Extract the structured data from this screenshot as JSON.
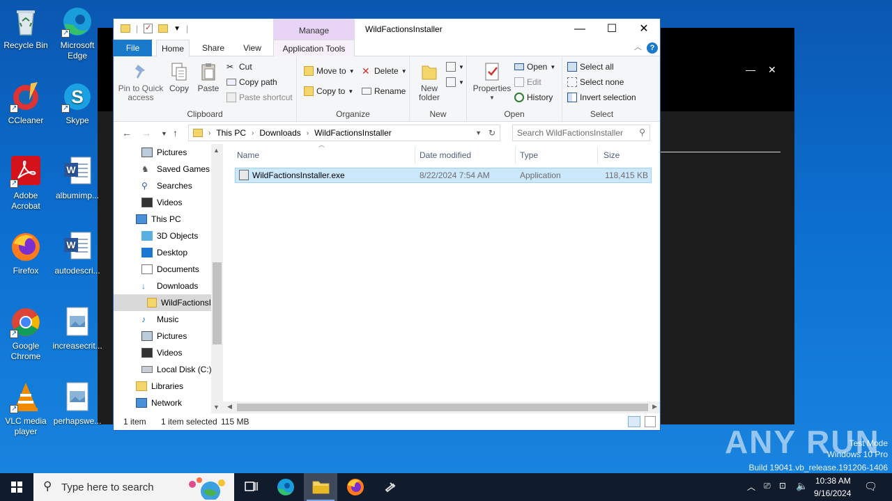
{
  "desktop_icons": [
    {
      "label": "Recycle Bin",
      "icon": "recycle-bin-icon"
    },
    {
      "label": "Microsoft Edge",
      "icon": "edge-icon"
    },
    {
      "label": "CCleaner",
      "icon": "ccleaner-icon"
    },
    {
      "label": "Skype",
      "icon": "skype-icon"
    },
    {
      "label": "Adobe Acrobat",
      "icon": "acrobat-icon"
    },
    {
      "label": "albumimp...",
      "icon": "word-doc-icon"
    },
    {
      "label": "Firefox",
      "icon": "firefox-icon"
    },
    {
      "label": "autodescri...",
      "icon": "word-doc-icon"
    },
    {
      "label": "Google Chrome",
      "icon": "chrome-icon"
    },
    {
      "label": "increasecrit...",
      "icon": "image-file-icon"
    },
    {
      "label": "VLC media player",
      "icon": "vlc-icon"
    },
    {
      "label": "perhapswe...",
      "icon": "image-file-icon"
    }
  ],
  "window": {
    "title": "WildFactionsInstaller",
    "manage_tab": "Manage",
    "tabs": {
      "file": "File",
      "home": "Home",
      "share": "Share",
      "view": "View",
      "app_tools": "Application Tools"
    }
  },
  "ribbon": {
    "clipboard": {
      "label": "Clipboard",
      "pin": "Pin to Quick access",
      "copy": "Copy",
      "paste": "Paste",
      "cut": "Cut",
      "copy_path": "Copy path",
      "paste_shortcut": "Paste shortcut"
    },
    "organize": {
      "label": "Organize",
      "move_to": "Move to",
      "copy_to": "Copy to",
      "delete": "Delete",
      "rename": "Rename"
    },
    "new": {
      "label": "New",
      "new_folder": "New folder"
    },
    "open": {
      "label": "Open",
      "properties": "Properties",
      "open": "Open",
      "edit": "Edit",
      "history": "History"
    },
    "select": {
      "label": "Select",
      "select_all": "Select all",
      "select_none": "Select none",
      "invert": "Invert selection"
    }
  },
  "address": {
    "crumbs": [
      "This PC",
      "Downloads",
      "WildFactionsInstaller"
    ],
    "search_placeholder": "Search WildFactionsInstaller"
  },
  "nav_items": [
    {
      "label": "Pictures",
      "icon": "pictures-folder-icon"
    },
    {
      "label": "Saved Games",
      "icon": "saved-games-icon"
    },
    {
      "label": "Searches",
      "icon": "searches-icon"
    },
    {
      "label": "Videos",
      "icon": "videos-folder-icon"
    },
    {
      "label": "This PC",
      "icon": "this-pc-icon"
    },
    {
      "label": "3D Objects",
      "icon": "3d-objects-icon"
    },
    {
      "label": "Desktop",
      "icon": "desktop-folder-icon"
    },
    {
      "label": "Documents",
      "icon": "documents-folder-icon"
    },
    {
      "label": "Downloads",
      "icon": "downloads-folder-icon"
    },
    {
      "label": "WildFactionsI",
      "icon": "folder-icon"
    },
    {
      "label": "Music",
      "icon": "music-folder-icon"
    },
    {
      "label": "Pictures",
      "icon": "pictures-folder-icon"
    },
    {
      "label": "Videos",
      "icon": "videos-folder-icon"
    },
    {
      "label": "Local Disk (C:)",
      "icon": "local-disk-icon"
    },
    {
      "label": "Libraries",
      "icon": "libraries-icon"
    },
    {
      "label": "Network",
      "icon": "network-icon"
    }
  ],
  "columns": {
    "name": "Name",
    "date": "Date modified",
    "type": "Type",
    "size": "Size"
  },
  "files": [
    {
      "name": "WildFactionsInstaller.exe",
      "date": "8/22/2024 7:54 AM",
      "type": "Application",
      "size": "118,415 KB"
    }
  ],
  "status": {
    "count": "1 item",
    "selected": "1 item selected",
    "size": "115 MB"
  },
  "watermark": {
    "mode": "Test Mode",
    "os": "Windows 10 Pro",
    "build": "Build 19041.vb_release.191206-1406",
    "brand": "ANY RUN"
  },
  "taskbar": {
    "search_placeholder": "Type here to search",
    "time": "10:38 AM",
    "date": "9/16/2024"
  }
}
